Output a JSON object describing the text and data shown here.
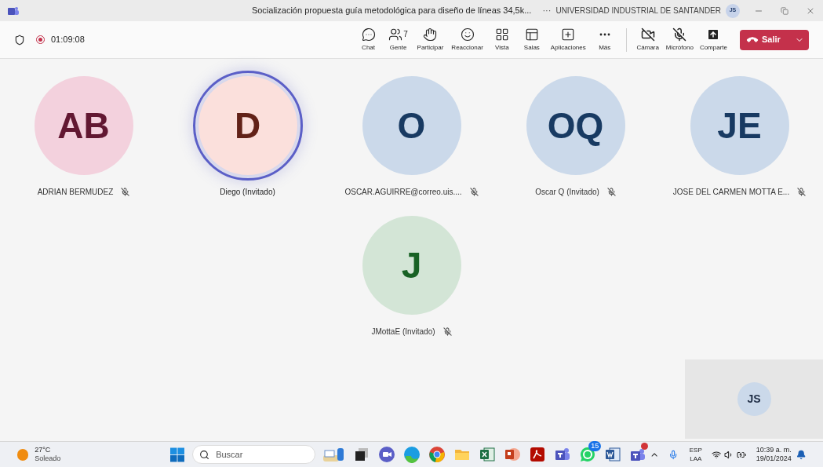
{
  "title_bar": {
    "title": "Socialización propuesta guía metodológica para diseño de líneas 34,5k...",
    "more": "···",
    "organization": "UNIVERSIDAD INDUSTRIAL DE SANTANDER",
    "user_initials": "JS"
  },
  "toolbar": {
    "recording": true,
    "elapsed": "01:09:08",
    "buttons": [
      {
        "kind": "chat",
        "label": "Chat"
      },
      {
        "kind": "people",
        "label": "Gente",
        "count": "7"
      },
      {
        "kind": "raise",
        "label": "Participar"
      },
      {
        "kind": "react",
        "label": "Reaccionar"
      },
      {
        "kind": "view",
        "label": "Vista"
      },
      {
        "kind": "rooms",
        "label": "Salas"
      },
      {
        "kind": "apps",
        "label": "Aplicaciones"
      },
      {
        "kind": "more",
        "label": "Más"
      }
    ],
    "devices": [
      {
        "kind": "camera",
        "label": "Cámara",
        "off": true
      },
      {
        "kind": "mic",
        "label": "Micrófono",
        "off": true
      },
      {
        "kind": "share",
        "label": "Comparte",
        "off": false
      }
    ],
    "leave": "Salir"
  },
  "participant_rows": [
    [
      {
        "initials": "AB",
        "name": "ADRIAN BERMUDEZ",
        "color": "#f3d1dd",
        "speaking": false,
        "muted": true
      },
      {
        "initials": "D",
        "name": "Diego (Invitado)",
        "color": "#fbe0dc",
        "speaking": true,
        "muted": false
      },
      {
        "initials": "O",
        "name": "OSCAR.AGUIRRE@correo.uis....",
        "color": "#cbd9ea",
        "speaking": false,
        "muted": true
      },
      {
        "initials": "OQ",
        "name": "Oscar Q (Invitado)",
        "color": "#cbd9ea",
        "speaking": false,
        "muted": true
      },
      {
        "initials": "JE",
        "name": "JOSE DEL CARMEN MOTTA E...",
        "color": "#cbd9ea",
        "speaking": false,
        "muted": true
      }
    ],
    [
      {
        "initials": "J",
        "name": "JMottaE (Invitado)",
        "color": "#d3e5d6",
        "speaking": false,
        "muted": true
      }
    ]
  ],
  "self_view": {
    "initials": "JS"
  },
  "taskbar": {
    "weather": {
      "temperature": "27°C",
      "condition": "Soleado"
    },
    "search": {
      "placeholder": "Buscar"
    },
    "apps": [
      {
        "kind": "widgets"
      },
      {
        "kind": "taskview"
      },
      {
        "kind": "meet"
      },
      {
        "kind": "edge"
      },
      {
        "kind": "chrome"
      },
      {
        "kind": "explorer"
      },
      {
        "kind": "excel"
      },
      {
        "kind": "powerpoint"
      },
      {
        "kind": "acrobat"
      },
      {
        "kind": "teams"
      },
      {
        "kind": "whatsapp",
        "badge": "15"
      },
      {
        "kind": "word"
      },
      {
        "kind": "teams-new",
        "notification": true
      }
    ],
    "language": "ESP",
    "layout": "LAA",
    "time": "10:39 a. m.",
    "date": "19/01/2024"
  }
}
